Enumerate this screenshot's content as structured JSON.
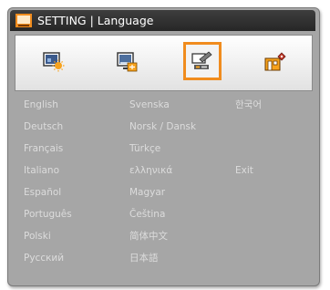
{
  "title": "SETTING | Language",
  "tabs": [
    {
      "icon": "image-settings-icon"
    },
    {
      "icon": "display-settings-icon"
    },
    {
      "icon": "setting-icon",
      "selected": true
    },
    {
      "icon": "options-icon"
    }
  ],
  "languages": {
    "col1": [
      "English",
      "Deutsch",
      "Français",
      "Italiano",
      "Español",
      "Português",
      "Polski",
      "Русский"
    ],
    "col2": [
      "Svenska",
      "Norsk / Dansk",
      "Türkçe",
      "ελληνικά",
      "Magyar",
      "Čeština",
      "简体中文",
      "日本語"
    ],
    "col3": [
      "한국어",
      "",
      "",
      "Exit"
    ]
  },
  "colors": {
    "accent": "#f08c1e",
    "panel": "#a6a6a6",
    "titlebar": "#2e2e2e",
    "text": "#dcdcdc"
  }
}
